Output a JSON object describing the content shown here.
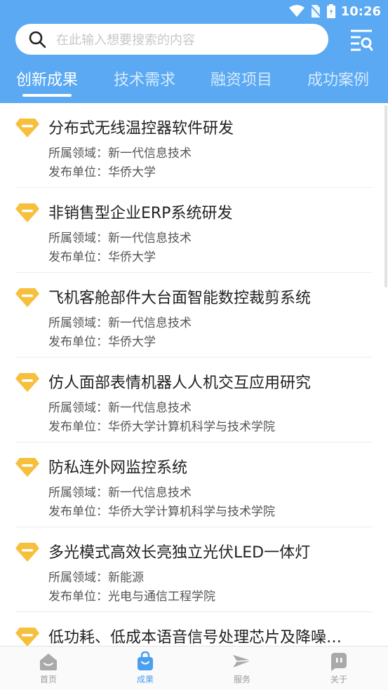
{
  "status": {
    "time": "10:26"
  },
  "search": {
    "placeholder": "在此输入想要搜索的内容"
  },
  "tabs": [
    {
      "label": "创新成果",
      "active": true
    },
    {
      "label": "技术需求",
      "active": false
    },
    {
      "label": "融资项目",
      "active": false
    },
    {
      "label": "成功案例",
      "active": false
    }
  ],
  "list": {
    "items": [
      {
        "title": "分布式无线温控器软件研发",
        "field": "所属领域：新一代信息技术",
        "publisher": "发布单位：华侨大学"
      },
      {
        "title": "非销售型企业ERP系统研发",
        "field": "所属领域：新一代信息技术",
        "publisher": "发布单位：华侨大学"
      },
      {
        "title": "飞机客舱部件大台面智能数控裁剪系统",
        "field": "所属领域：新一代信息技术",
        "publisher": "发布单位：华侨大学"
      },
      {
        "title": "仿人面部表情机器人人机交互应用研究",
        "field": "所属领域：新一代信息技术",
        "publisher": "发布单位：华侨大学计算机科学与技术学院"
      },
      {
        "title": "防私连外网监控系统",
        "field": "所属领域：新一代信息技术",
        "publisher": "发布单位：华侨大学计算机科学与技术学院"
      },
      {
        "title": "多光模式高效长亮独立光伏LED一体灯",
        "field": "所属领域：新能源",
        "publisher": "发布单位：光电与通信工程学院"
      },
      {
        "title": "低功耗、低成本语音信号处理芯片及降噪…",
        "field": "",
        "publisher": ""
      }
    ]
  },
  "nav": [
    {
      "label": "首页",
      "icon": "home-icon",
      "active": false
    },
    {
      "label": "成果",
      "icon": "bag-icon",
      "active": true
    },
    {
      "label": "服务",
      "icon": "send-icon",
      "active": false
    },
    {
      "label": "关于",
      "icon": "chat-icon",
      "active": false
    }
  ],
  "colors": {
    "primary": "#5aa9f2",
    "accent": "#f6c03d",
    "active_nav": "#4b9ff0"
  }
}
